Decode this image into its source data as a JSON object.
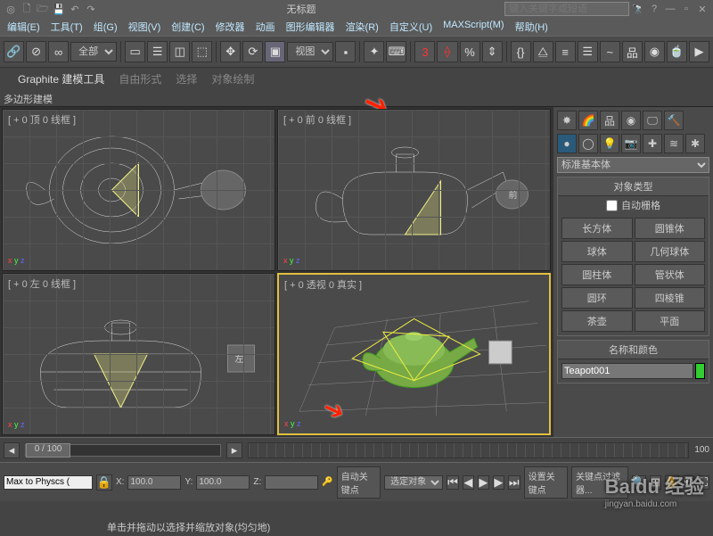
{
  "title_bar": {
    "document_title": "无标题",
    "search_placeholder": "键入关键字或短语"
  },
  "menus": [
    "编辑(E)",
    "工具(T)",
    "组(G)",
    "视图(V)",
    "创建(C)",
    "修改器",
    "动画",
    "图形编辑器",
    "渲染(R)",
    "自定义(U)",
    "MAXScript(M)",
    "帮助(H)"
  ],
  "toolbar": {
    "selection_filter": "全部",
    "ref_coord": "视图",
    "angle_snap": "3",
    "percent": "%"
  },
  "ribbon": {
    "tab_active": "Graphite 建模工具",
    "tabs": [
      "Graphite 建模工具",
      "自由形式",
      "选择",
      "对象绘制"
    ],
    "sublabel": "多边形建模"
  },
  "viewports": {
    "top": "[ + 0 顶 0 线框 ]",
    "front": "[ + 0 前 0 线框 ]",
    "left": "[ + 0 左 0 线框 ]",
    "persp": "[ + 0 透视 0 真实 ]",
    "front_cube": "前",
    "left_cube": "左"
  },
  "command_panel": {
    "category": "标准基本体",
    "roll_type": "对象类型",
    "autogrid": "自动栅格",
    "primitives": [
      "长方体",
      "圆锥体",
      "球体",
      "几何球体",
      "圆柱体",
      "管状体",
      "圆环",
      "四棱锥",
      "茶壶",
      "平面"
    ],
    "roll_name": "名称和颜色",
    "object_name": "Teapot001"
  },
  "timeline": {
    "frame": "0 / 100",
    "end": "100"
  },
  "status": {
    "script_field": "Max to Physcs (",
    "x_label": "X:",
    "x_val": "100.0",
    "y_label": "Y:",
    "y_val": "100.0",
    "z_label": "Z:",
    "z_val": "",
    "autokey": "自动关键点",
    "selected": "选定对象",
    "setkey": "设置关键点",
    "keyfilter": "关键点过滤器...",
    "prompt": "单击并拖动以选择并缩放对象(均匀地)"
  },
  "watermark": {
    "brand": "Baidu 经验",
    "sub": "jingyan.baidu.com"
  },
  "arrows": {}
}
